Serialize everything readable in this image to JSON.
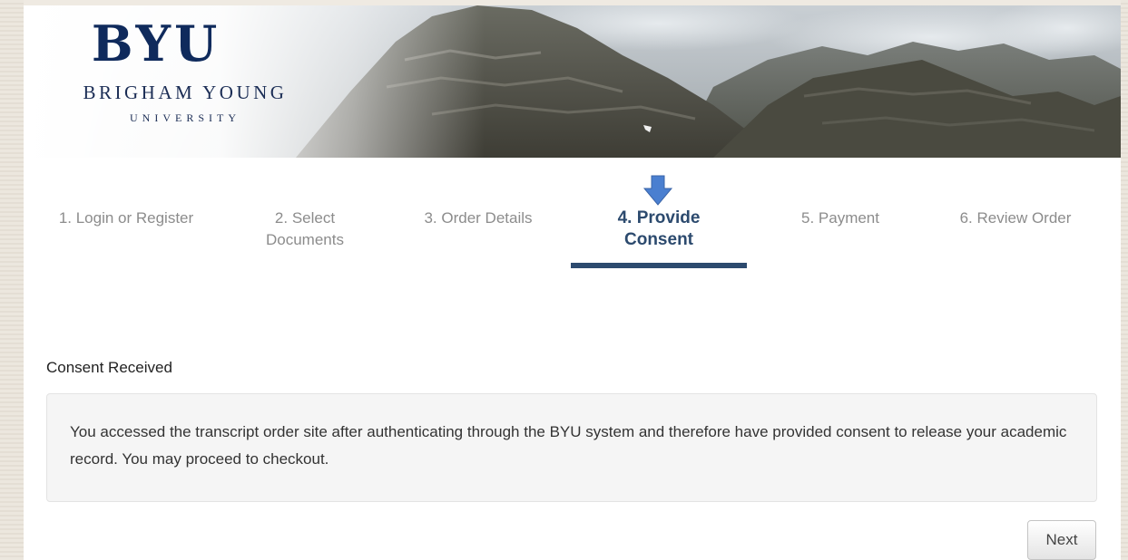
{
  "header": {
    "logo_main": "BYU",
    "logo_line1": "BRIGHAM YOUNG",
    "logo_line2": "UNIVERSITY"
  },
  "steps": {
    "items": [
      {
        "label": "1. Login or Register",
        "state": "inactive"
      },
      {
        "label": "2. Select Documents",
        "state": "inactive"
      },
      {
        "label": "3. Order Details",
        "state": "inactive"
      },
      {
        "label": "4. Provide Consent",
        "state": "active"
      },
      {
        "label": "5. Payment",
        "state": "inactive"
      },
      {
        "label": "6. Review Order",
        "state": "inactive"
      }
    ],
    "current_indicator_icon": "arrow-down-icon"
  },
  "content": {
    "title": "Consent Received",
    "message": "You accessed the transcript order site after authenticating through the BYU system and therefore have provided consent to release your academic record. You may proceed to checkout."
  },
  "actions": {
    "next_label": "Next"
  },
  "colors": {
    "brand_navy": "#0f2a5c",
    "active_step": "#2c4a6e",
    "inactive_step": "#8c8c8c",
    "arrow_blue": "#4a7fd0"
  }
}
